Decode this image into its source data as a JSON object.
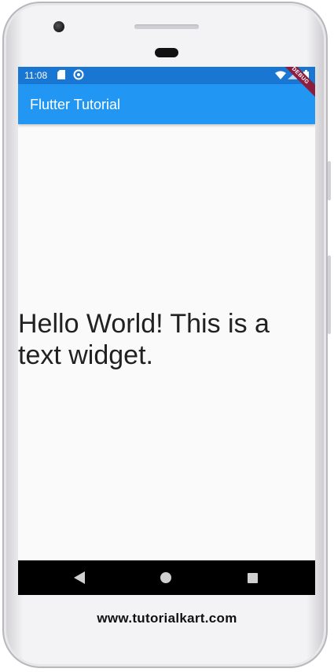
{
  "status_bar": {
    "time": "11:08",
    "icons": [
      "sd-card-icon",
      "sync-icon",
      "wifi-icon",
      "signal-icon",
      "battery-icon"
    ],
    "color": "#1976d2"
  },
  "app_bar": {
    "title": "Flutter Tutorial",
    "color": "#2196f3",
    "debug_banner": "DEBUG"
  },
  "content": {
    "text": "Hello World! This is a text widget."
  },
  "nav_bar": {
    "buttons": [
      "back-icon",
      "home-icon",
      "recents-icon"
    ]
  },
  "footer": {
    "text": "www.tutorialkart.com"
  }
}
